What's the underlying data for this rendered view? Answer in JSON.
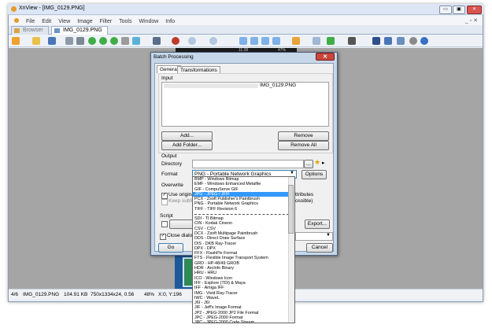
{
  "app": {
    "title": "XnView - [IMG_0129.PNG]",
    "window_controls": {
      "minimize": "▭",
      "restore": "▣",
      "close": "✕"
    },
    "menu": [
      "File",
      "Edit",
      "View",
      "Image",
      "Filter",
      "Tools",
      "Window",
      "Info"
    ],
    "tabs": [
      {
        "label": "Browser",
        "active": false
      },
      {
        "label": "IMG_0129.PNG",
        "active": true
      }
    ],
    "viewer_overlay": {
      "time": "11:28",
      "battery": "47%"
    }
  },
  "status": {
    "index": "4/6",
    "filename": "IMG_0129.PNG",
    "size": "104.91 KB",
    "dims": "750x1334x24, 0.56",
    "zoom": "48%",
    "coords": "X:0, Y:196"
  },
  "dialog": {
    "title": "Batch Processing",
    "tabs": [
      "General",
      "Transformations"
    ],
    "input": {
      "label": "Input",
      "file_line": "IMG_0129.PNG",
      "add_label": "Add...",
      "add_folder_label": "Add Folder...",
      "remove_label": "Remove",
      "remove_all_label": "Remove All"
    },
    "output": {
      "label": "Output",
      "directory_label": "Directory",
      "format_label": "Format",
      "format_value": "PNG - Portable Network Graphics",
      "options_label": "Options",
      "overwrite_label": "Overwrite",
      "use_original_label": "Use original p",
      "keep_subfolders_label": "Keep subfolde",
      "attributes_label": "ttributes",
      "possible_label": "ossible)"
    },
    "script": {
      "label": "Script",
      "export_label": "Export..."
    },
    "close_dialog_label": "Close dialog after",
    "go_label": "Go",
    "cancel_label": "Cancel"
  },
  "dropdown": {
    "items_top": [
      "BMP - Windows Bitmap",
      "EMF - Windows Enhanced Metafile",
      "GIF - CompuServe GIF",
      "JPG - JPEG / JFIF",
      "PCX - Zsoft Publisher's Paintbrush",
      "PNG - Portable Network Graphics",
      "TIFF - TIFF Revision 6"
    ],
    "selected_index": 3,
    "items_bottom": [
      "SDI - TI Bitmap",
      "CIN - Kodak Cineon",
      "CSV - CSV",
      "DCX - Zsoft Multipage Paintbrush",
      "DDS - Direct Draw Surface",
      "DIS - DKB Ray-Tracer",
      "DPX - DPX",
      "FFX - FlashPix Format",
      "FTS - Flexible Image Transport System",
      "GRD - HP-48/49 GROB",
      "HDR - ArcInfo Binary",
      "HRU - HRU",
      "ICO - Windows Icon",
      "IFF - Explore (TDI) & Maya",
      "IFF - Amiga IFF",
      "IMG - Vivid Ray-Tracer",
      "IWC - WaveL",
      "J6I - J6I",
      "JIF - Jeff's Image Format",
      "JP2 - JPEG-2000 JP2 File Format",
      "JPC - JPEG-2000 Format",
      "JPC - JPEG-2000 Code Stream"
    ]
  }
}
